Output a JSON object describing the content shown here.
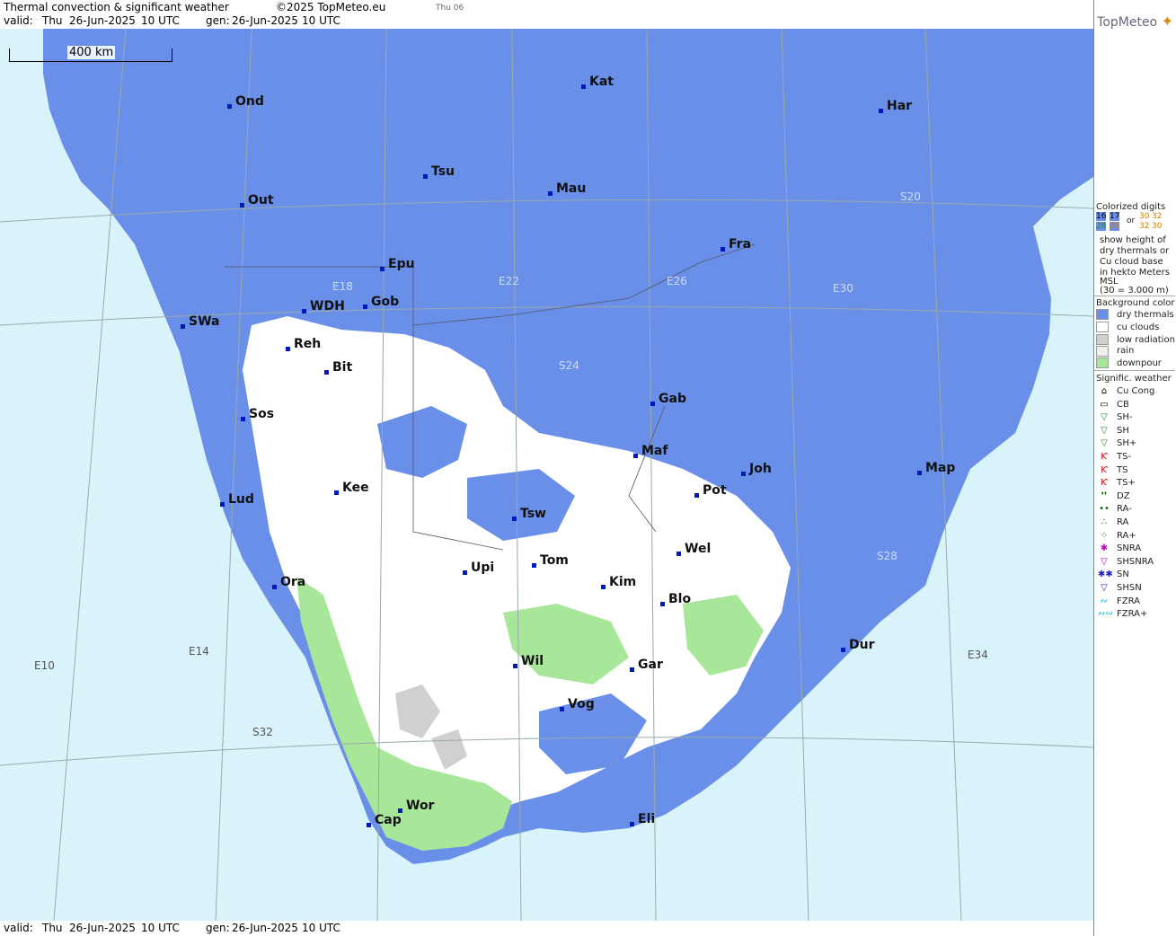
{
  "header": {
    "title": "Thermal convection & significant weather",
    "copyright": "©2025 TopMeteo.eu",
    "day_tag": "Thu 06",
    "valid_label": "valid:",
    "valid_day": "Thu",
    "valid_date": "26-Jun-2025",
    "valid_time": "10 UTC",
    "gen_label": "gen:",
    "gen_date": "26-Jun-2025",
    "gen_time": "10 UTC",
    "brand": "TopMeteo"
  },
  "map": {
    "scale_label": "400 km",
    "cities": [
      {
        "code": "Ond"
      },
      {
        "code": "Kat"
      },
      {
        "code": "Har"
      },
      {
        "code": "Tsu"
      },
      {
        "code": "Out"
      },
      {
        "code": "Mau"
      },
      {
        "code": "Fra"
      },
      {
        "code": "Epu"
      },
      {
        "code": "Gob"
      },
      {
        "code": "WDH"
      },
      {
        "code": "SWa"
      },
      {
        "code": "Reh"
      },
      {
        "code": "Bit"
      },
      {
        "code": "Gab"
      },
      {
        "code": "Sos"
      },
      {
        "code": "Maf"
      },
      {
        "code": "Joh"
      },
      {
        "code": "Map"
      },
      {
        "code": "Pot"
      },
      {
        "code": "Kee"
      },
      {
        "code": "Lud"
      },
      {
        "code": "Tsw"
      },
      {
        "code": "Wel"
      },
      {
        "code": "Tom"
      },
      {
        "code": "Upi"
      },
      {
        "code": "Kim"
      },
      {
        "code": "Ora"
      },
      {
        "code": "Blo"
      },
      {
        "code": "Dur"
      },
      {
        "code": "Wil"
      },
      {
        "code": "Gar"
      },
      {
        "code": "Vog"
      },
      {
        "code": "Wor"
      },
      {
        "code": "Cap"
      },
      {
        "code": "Eli"
      }
    ],
    "grid_labels": [
      "E10",
      "E14",
      "E18",
      "E22",
      "E26",
      "E30",
      "E34",
      "S20",
      "S24",
      "S28",
      "S32"
    ],
    "colors": {
      "sea": "#d9f3fb",
      "dry_thermals": "#6a8fe8",
      "cu_clouds": "#ffffff",
      "low_radiation": "#d0d0d0",
      "downpour": "#a8e69a"
    }
  },
  "legend": {
    "colorized_title": "Colorized digits",
    "colorized_samples": [
      "16",
      "17",
      "30",
      "32",
      "28",
      "26",
      "32",
      "30"
    ],
    "or_label": "or",
    "desc_lines": [
      "show height of",
      "dry thermals or",
      "Cu cloud base",
      "in hekto Meters",
      "MSL",
      "(30 = 3.000 m)"
    ],
    "bg_title": "Background color",
    "bg_items": [
      {
        "label": "dry thermals",
        "color": "#6a8fe8"
      },
      {
        "label": "cu clouds",
        "color": "#ffffff"
      },
      {
        "label": "low radiation",
        "color": "#d0d0d0"
      },
      {
        "label": "rain",
        "color": "#eeeeee"
      },
      {
        "label": "downpour",
        "color": "#a8e69a"
      }
    ],
    "weather_title": "Signific. weather",
    "weather_items": [
      {
        "label": "Cu Cong",
        "icon": "cu-cong-icon",
        "glyph": "⌂",
        "color": "#000"
      },
      {
        "label": "CB",
        "icon": "cb-icon",
        "glyph": "▭",
        "color": "#000"
      },
      {
        "label": "SH-",
        "icon": "shower-light-icon",
        "glyph": "▽",
        "color": "#2a8a2a"
      },
      {
        "label": "SH",
        "icon": "shower-icon",
        "glyph": "▽",
        "color": "#2a8a2a"
      },
      {
        "label": "SH+",
        "icon": "shower-heavy-icon",
        "glyph": "▽",
        "color": "#2a8a2a"
      },
      {
        "label": "TS-",
        "icon": "thunder-light-icon",
        "glyph": "Ƙ",
        "color": "#c00"
      },
      {
        "label": "TS",
        "icon": "thunder-icon",
        "glyph": "Ƙ",
        "color": "#c00"
      },
      {
        "label": "TS+",
        "icon": "thunder-heavy-icon",
        "glyph": "Ƙ",
        "color": "#c00"
      },
      {
        "label": "DZ",
        "icon": "drizzle-icon",
        "glyph": "❜❜",
        "color": "#060"
      },
      {
        "label": "RA-",
        "icon": "rain-light-icon",
        "glyph": "••",
        "color": "#060"
      },
      {
        "label": "RA",
        "icon": "rain-icon",
        "glyph": "∴",
        "color": "#060"
      },
      {
        "label": "RA+",
        "icon": "rain-heavy-icon",
        "glyph": "⁘",
        "color": "#060"
      },
      {
        "label": "SNRA",
        "icon": "snow-rain-icon",
        "glyph": "✱",
        "color": "#b0b"
      },
      {
        "label": "SHSNRA",
        "icon": "snow-rain-shower-icon",
        "glyph": "▽",
        "color": "#b0b"
      },
      {
        "label": "SN",
        "icon": "snow-icon",
        "glyph": "✱✱",
        "color": "#22c"
      },
      {
        "label": "SHSN",
        "icon": "snow-shower-icon",
        "glyph": "▽",
        "color": "#22c"
      },
      {
        "label": "FZRA",
        "icon": "freezing-rain-icon",
        "glyph": "∾",
        "color": "#0bc"
      },
      {
        "label": "FZRA+",
        "icon": "freezing-rain-heavy-icon",
        "glyph": "∾∾",
        "color": "#0bc"
      }
    ]
  }
}
